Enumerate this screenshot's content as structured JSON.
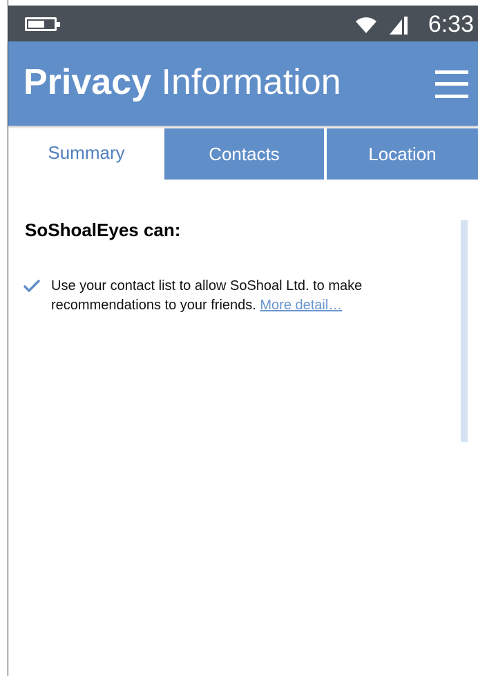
{
  "status_bar": {
    "time": "6:33",
    "battery_level": 0.65,
    "icons": [
      "battery-icon",
      "wifi-icon",
      "cell-signal-icon"
    ]
  },
  "app_bar": {
    "title_bold": "Privacy",
    "title_regular": " Information",
    "menu_icon": "hamburger-menu-icon"
  },
  "tabs": [
    {
      "label": "Summary",
      "selected": true
    },
    {
      "label": "Contacts",
      "selected": false
    },
    {
      "label": "Location",
      "selected": false
    }
  ],
  "content": {
    "heading": "SoShoalEyes can:",
    "items": [
      {
        "icon": "checkmark-icon",
        "text": "Use your contact list to allow SoShoal Ltd. to make recommendations to your friends.",
        "link": "More detail…"
      }
    ]
  },
  "colors": {
    "status_bar": "#4a5058",
    "app_bar": "#608ec9",
    "tab_active_text": "#4f7fbd",
    "link": "#6a96cf",
    "scroll_track": "#d6e2f2"
  }
}
